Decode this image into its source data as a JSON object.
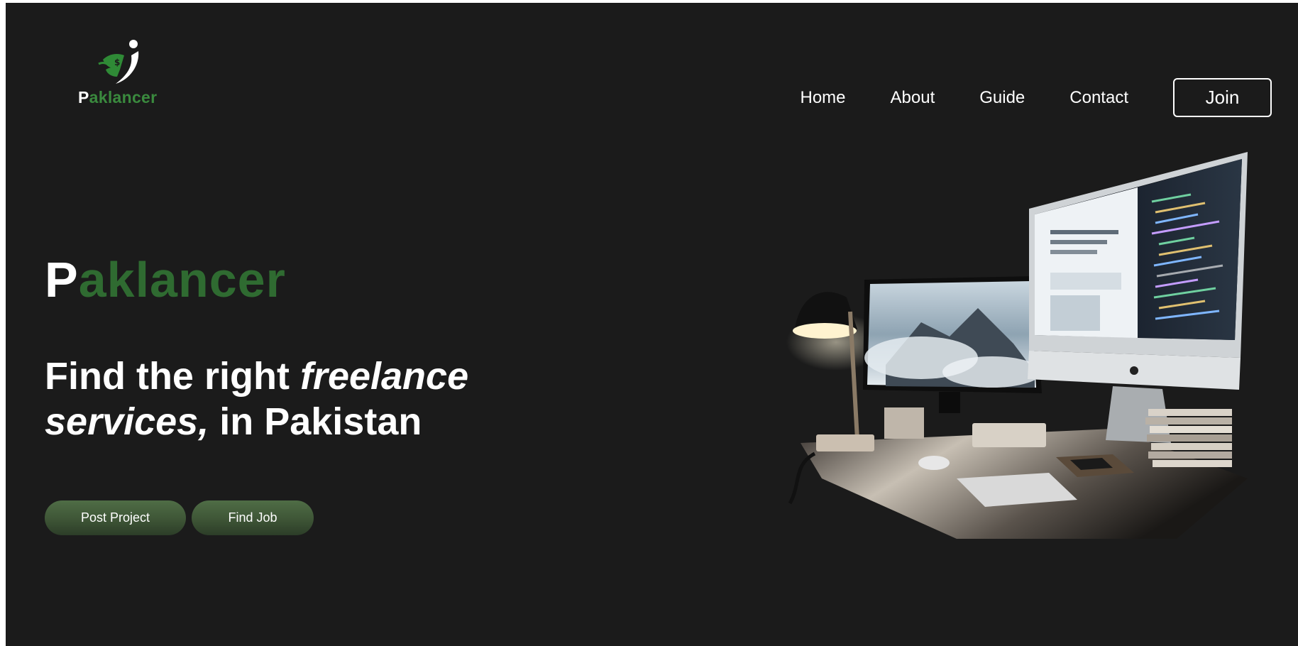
{
  "logo": {
    "first_letter": "P",
    "rest": "aklancer",
    "icon": "freelancer-logo-icon"
  },
  "nav": {
    "items": [
      {
        "label": "Home"
      },
      {
        "label": "About"
      },
      {
        "label": "Guide"
      },
      {
        "label": "Contact"
      }
    ],
    "join_label": "Join"
  },
  "hero": {
    "brand_first": "P",
    "brand_rest": "aklancer",
    "headline_part1": "Find the right ",
    "headline_em1": "freelance services,",
    "headline_part2": " in Pakistan",
    "post_project_label": "Post Project",
    "find_job_label": "Find Job"
  },
  "colors": {
    "background": "#1b1b1b",
    "brand_green": "#2f6b31",
    "logo_green": "#3a8a3e",
    "button_green": "#3e5536",
    "text": "#ffffff"
  },
  "illustration": {
    "icon": "desk-workstation-illustration"
  }
}
